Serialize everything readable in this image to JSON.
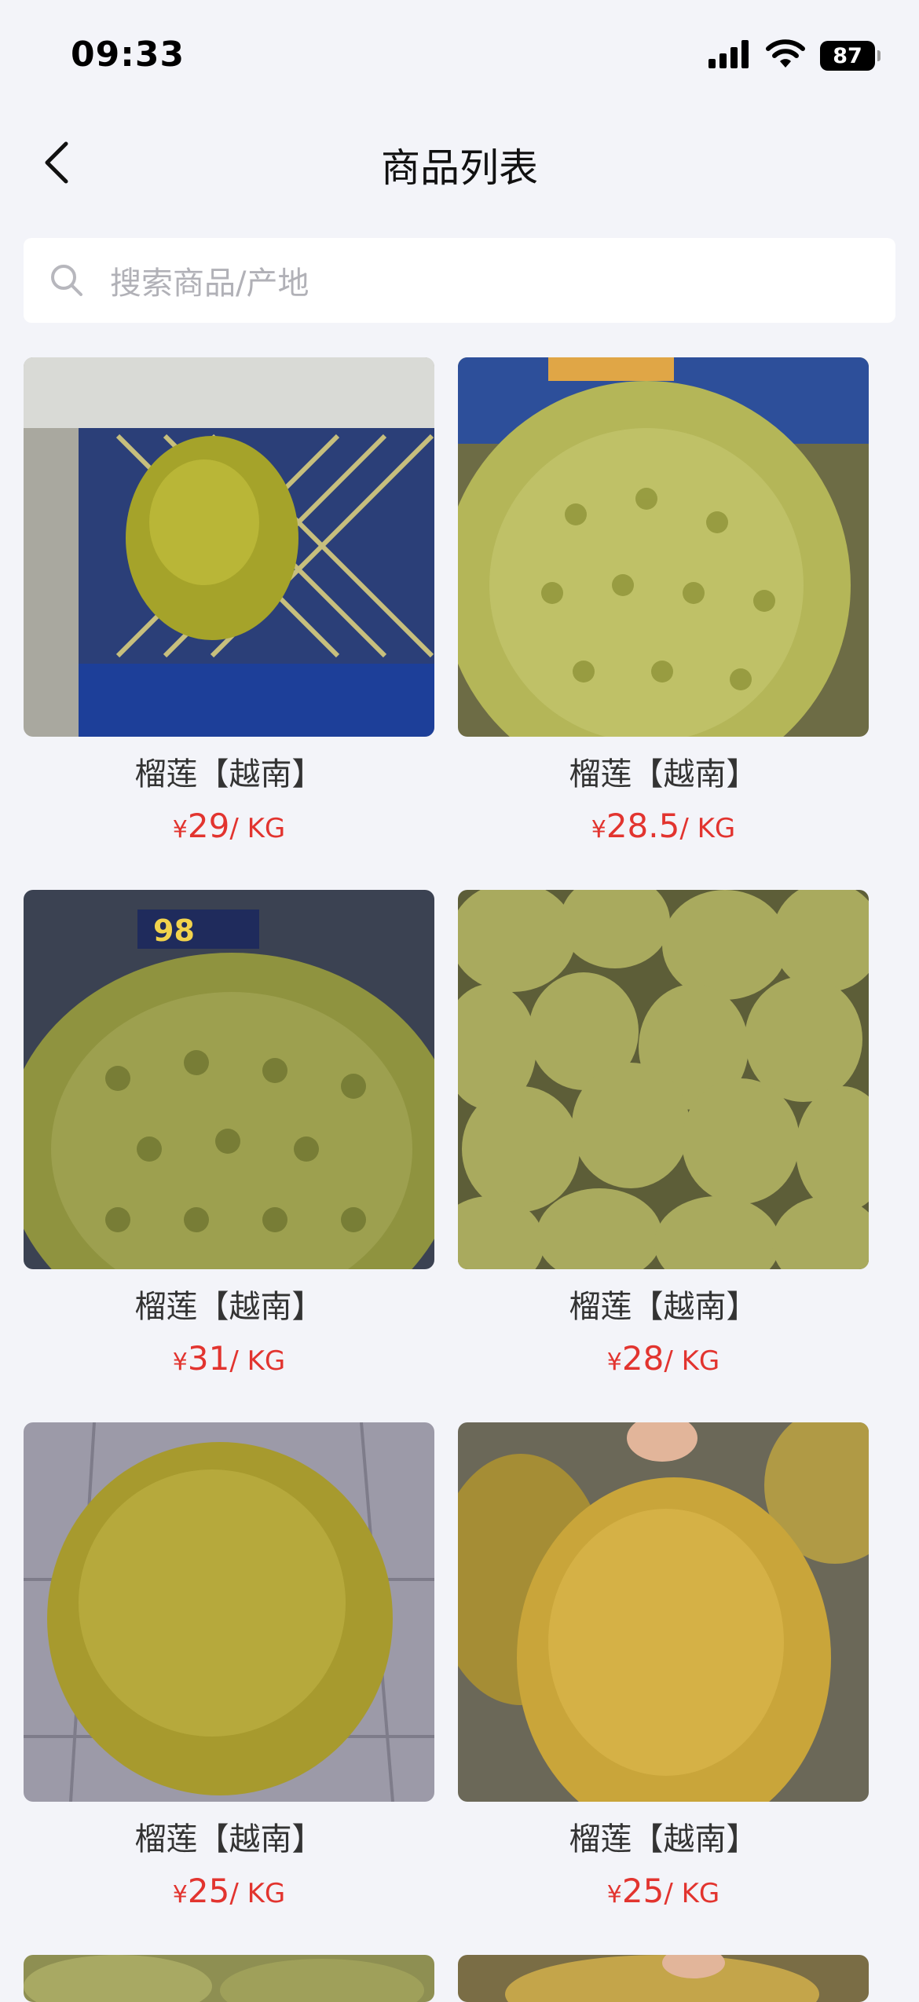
{
  "status": {
    "time": "09:33",
    "battery": "87"
  },
  "nav": {
    "title": "商品列表"
  },
  "search": {
    "placeholder": "搜索商品/产地"
  },
  "products": [
    {
      "name": "榴莲【越南】",
      "currency": "¥",
      "price": "29",
      "unit": "/ KG"
    },
    {
      "name": "榴莲【越南】",
      "currency": "¥",
      "price": "28.5",
      "unit": "/ KG"
    },
    {
      "name": "榴莲【越南】",
      "currency": "¥",
      "price": "31",
      "unit": "/ KG"
    },
    {
      "name": "榴莲【越南】",
      "currency": "¥",
      "price": "28",
      "unit": "/ KG"
    },
    {
      "name": "榴莲【越南】",
      "currency": "¥",
      "price": "25",
      "unit": "/ KG"
    },
    {
      "name": "榴莲【越南】",
      "currency": "¥",
      "price": "25",
      "unit": "/ KG"
    }
  ],
  "colors": {
    "price": "#e2342f",
    "background": "#f3f4f9"
  }
}
